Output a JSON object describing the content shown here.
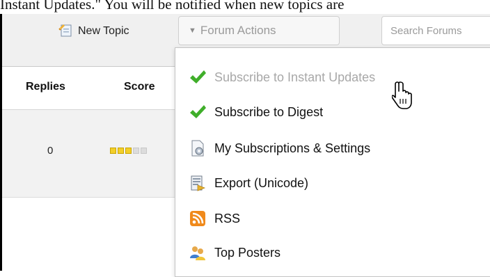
{
  "caption": "Instant Updates.\" You will be notified when new topics are",
  "toolbar": {
    "new_topic_label": "New Topic",
    "forum_actions_label": "Forum Actions",
    "search_placeholder": "Search Forums"
  },
  "table": {
    "columns": [
      "Replies",
      "Score"
    ],
    "rows": [
      {
        "replies": "0",
        "score_filled": 3,
        "score_total": 5
      }
    ]
  },
  "menu": {
    "items": [
      {
        "label": "Subscribe to Instant Updates",
        "icon": "checkmark-icon",
        "disabled": true
      },
      {
        "label": "Subscribe to Digest",
        "icon": "checkmark-icon",
        "disabled": false
      },
      {
        "label": "My Subscriptions & Settings",
        "icon": "settings-page-icon",
        "disabled": false
      },
      {
        "label": "Export (Unicode)",
        "icon": "export-icon",
        "disabled": false
      },
      {
        "label": "RSS",
        "icon": "rss-icon",
        "disabled": false
      },
      {
        "label": "Top Posters",
        "icon": "users-icon",
        "disabled": false
      }
    ]
  },
  "colors": {
    "check_green": "#3fae2a",
    "rss_orange": "#f08a1c",
    "score_yellow": "#f3cf29"
  }
}
